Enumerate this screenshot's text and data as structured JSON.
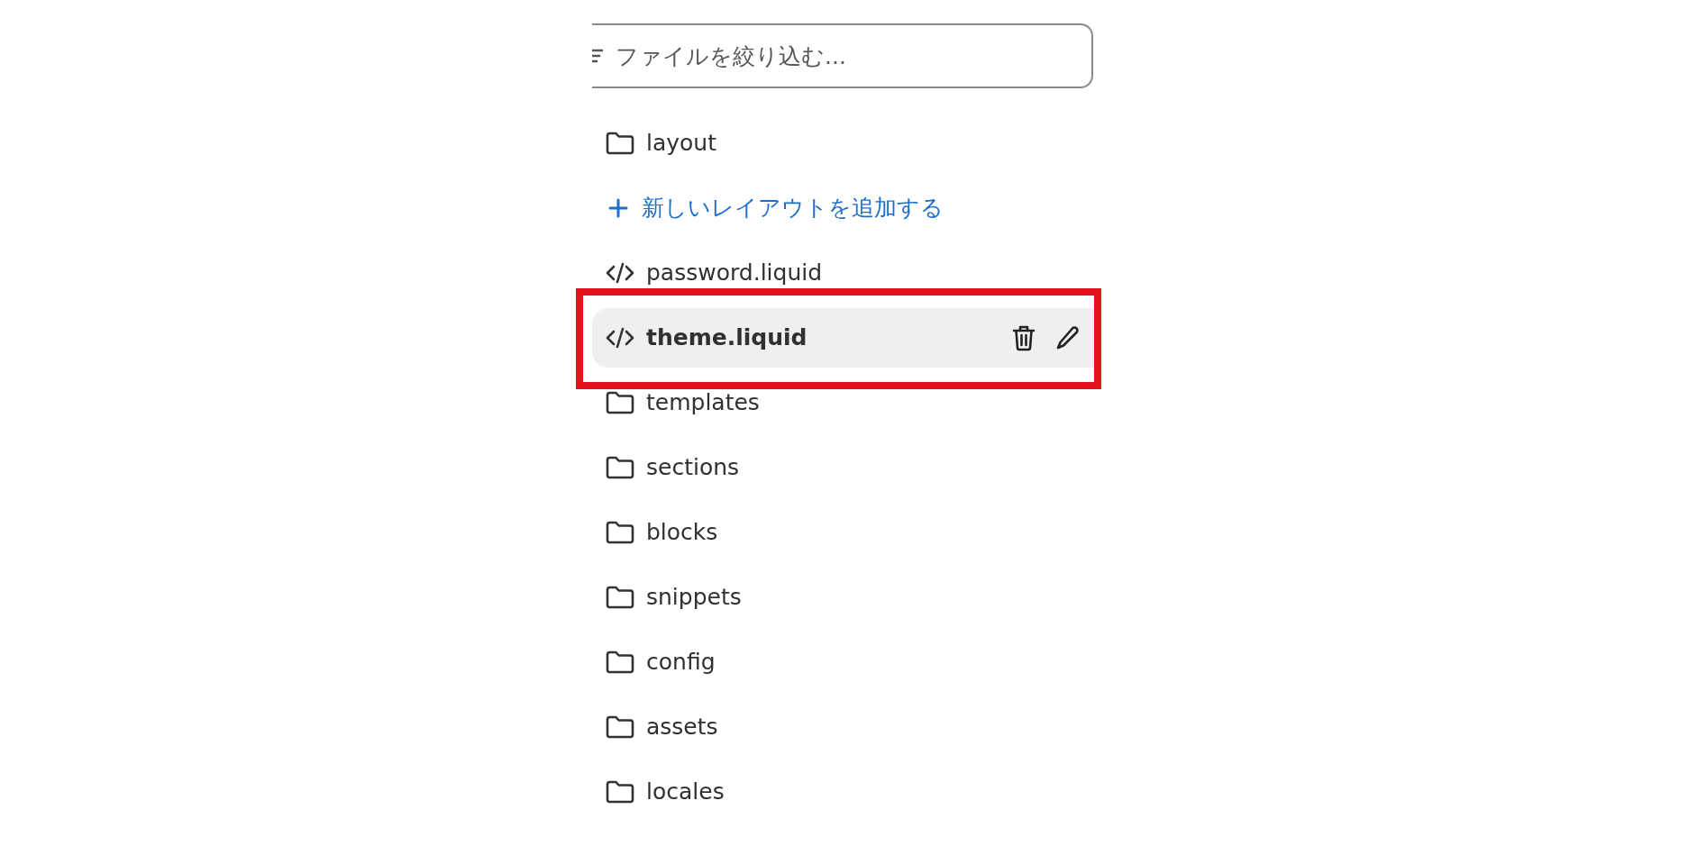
{
  "filter_field": {
    "placeholder": "ファイルを絞り込む..."
  },
  "items": [
    {
      "kind": "folder",
      "label": "layout",
      "selected": false
    },
    {
      "kind": "add",
      "label": "新しいレイアウトを追加する"
    },
    {
      "kind": "file",
      "label": "password.liquid",
      "selected": false
    },
    {
      "kind": "file",
      "label": "theme.liquid",
      "selected": true
    },
    {
      "kind": "folder",
      "label": "templates",
      "selected": false
    },
    {
      "kind": "folder",
      "label": "sections",
      "selected": false
    },
    {
      "kind": "folder",
      "label": "blocks",
      "selected": false
    },
    {
      "kind": "folder",
      "label": "snippets",
      "selected": false
    },
    {
      "kind": "folder",
      "label": "config",
      "selected": false
    },
    {
      "kind": "folder",
      "label": "assets",
      "selected": false
    },
    {
      "kind": "folder",
      "label": "locales",
      "selected": false
    }
  ]
}
